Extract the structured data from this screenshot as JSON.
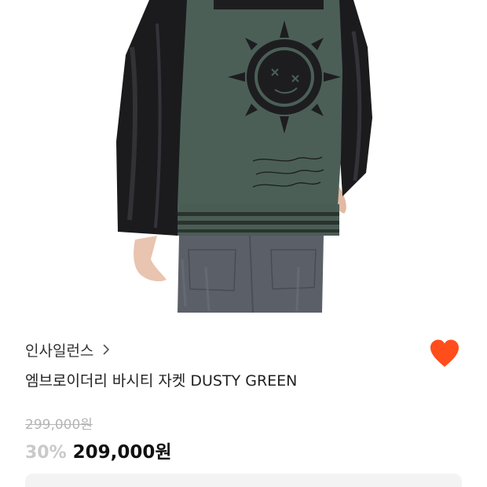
{
  "product": {
    "brand": "인사일런스",
    "title": "엠브로이더리 바시티 자켓 DUSTY GREEN",
    "original_price": "299,000원",
    "discount": "30%",
    "price": "209,000원",
    "favorited": true
  },
  "icons": {
    "brand_chevron": "chevron-right-icon",
    "wishlist": "heart-icon"
  },
  "colors": {
    "heart": "#ff4d1c",
    "jacket_body": "#4a5e56",
    "sleeves": "#1c1c1e",
    "jeans": "#5a5f66"
  }
}
